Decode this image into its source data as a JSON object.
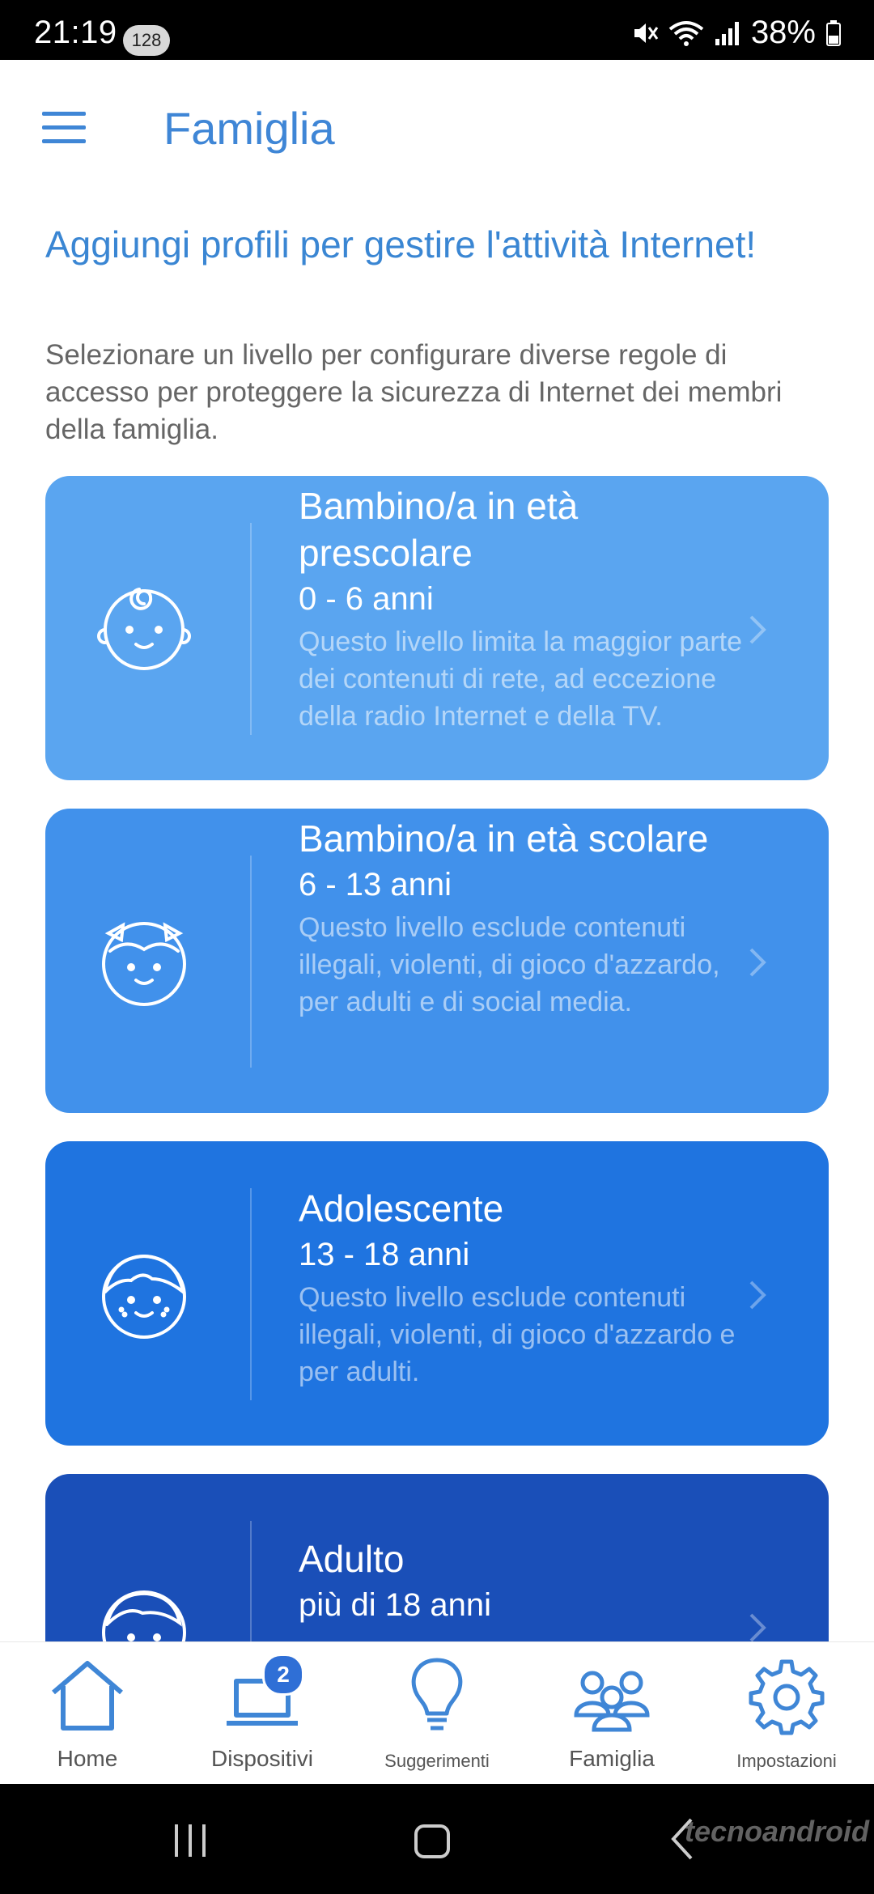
{
  "status_bar": {
    "time": "21:19",
    "badge": "128",
    "battery": "38%",
    "icons": [
      "mute-icon",
      "wifi-icon",
      "signal-icon",
      "battery-icon"
    ]
  },
  "header": {
    "title": "Famiglia",
    "menu_icon": "menu-icon"
  },
  "intro": {
    "title": "Aggiungi profili per gestire l'attività Internet!",
    "description": "Selezionare un livello per configurare diverse regole di accesso per proteggere la sicurezza di Internet dei membri della famiglia."
  },
  "profiles": [
    {
      "name": "Bambino/a in età prescolare",
      "age": "0 - 6 anni",
      "description": "Questo livello limita la maggior parte dei contenuti di rete, ad eccezione della radio Internet e della TV.",
      "color": "#5aa5f0",
      "icon": "baby-face-icon"
    },
    {
      "name": "Bambino/a in età scolare",
      "age": "6 - 13 anni",
      "description": "Questo livello esclude contenuti illegali, violenti, di gioco d'azzardo, per adulti e di social media.",
      "color": "#4191eb",
      "icon": "child-face-icon"
    },
    {
      "name": "Adolescente",
      "age": "13 - 18 anni",
      "description": "Questo livello esclude contenuti illegali, violenti, di gioco d'azzardo e per adulti.",
      "color": "#1f74e0",
      "icon": "teen-face-icon"
    },
    {
      "name": "Adulto",
      "age": "più di 18 anni",
      "description": "",
      "color": "#1a4fb8",
      "icon": "adult-face-icon"
    }
  ],
  "bottom_nav": {
    "items": [
      {
        "label": "Home",
        "icon": "home-icon"
      },
      {
        "label": "Dispositivi",
        "icon": "laptop-icon",
        "badge": "2"
      },
      {
        "label": "Suggerimenti",
        "icon": "lightbulb-icon"
      },
      {
        "label": "Famiglia",
        "icon": "family-icon"
      },
      {
        "label": "Impostazioni",
        "icon": "gear-icon"
      }
    ],
    "accent": "#3f86d6"
  },
  "system_nav": [
    "recents-icon",
    "home-circle-icon",
    "back-icon"
  ],
  "watermark": "tecnoandroid"
}
